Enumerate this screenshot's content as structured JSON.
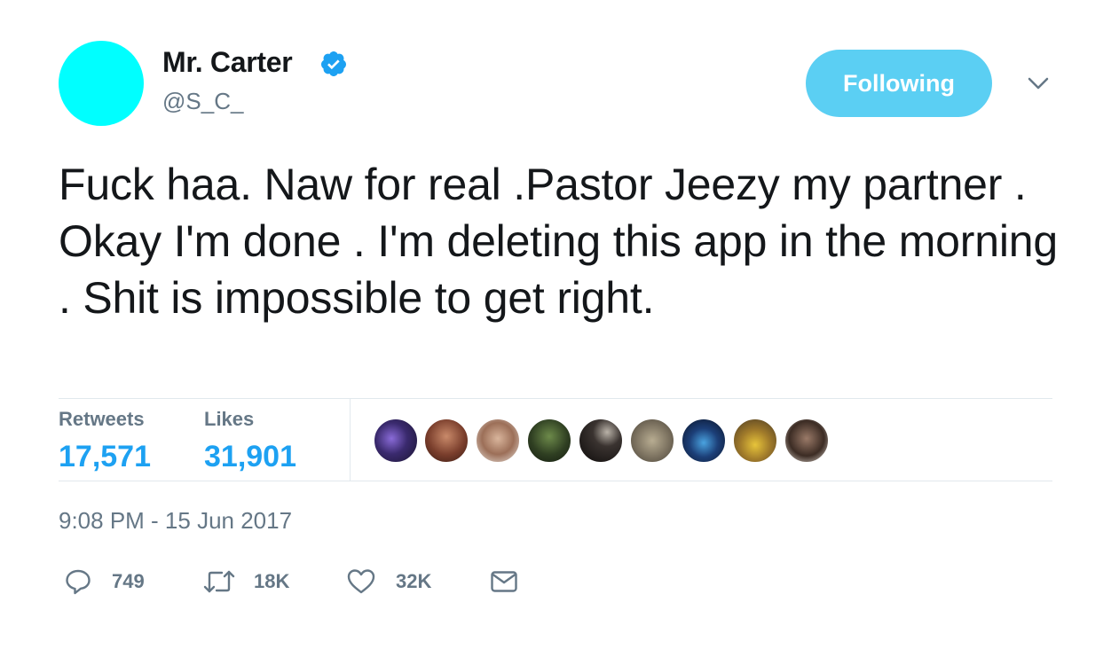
{
  "author": {
    "name": "Mr. Carter",
    "handle": "@S_C_",
    "verified": true,
    "avatar_color": "#00ffff",
    "avatar_icon": "avatar"
  },
  "follow_button": {
    "label": "Following",
    "color": "#5bcff3"
  },
  "menu": {
    "icon": "chevron-down-icon"
  },
  "tweet": {
    "text": "Fuck haa. Naw for real .Pastor Jeezy my partner . Okay I'm done . I'm deleting this app in the morning . Shit is impossible to get right."
  },
  "stats": {
    "retweets_label": "Retweets",
    "retweets_value": "17,571",
    "likes_label": "Likes",
    "likes_value": "31,901",
    "value_color": "#1da1f2"
  },
  "likers": [
    {
      "icon": "liker-avatar-1"
    },
    {
      "icon": "liker-avatar-2"
    },
    {
      "icon": "liker-avatar-3"
    },
    {
      "icon": "liker-avatar-4"
    },
    {
      "icon": "liker-avatar-5"
    },
    {
      "icon": "liker-avatar-6"
    },
    {
      "icon": "liker-avatar-7"
    },
    {
      "icon": "liker-avatar-8"
    },
    {
      "icon": "liker-avatar-9"
    }
  ],
  "timestamp": "9:08 PM - 15 Jun 2017",
  "actions": {
    "reply_count": "749",
    "retweet_count": "18K",
    "like_count": "32K",
    "reply_icon": "reply-icon",
    "retweet_icon": "retweet-icon",
    "like_icon": "heart-icon",
    "dm_icon": "envelope-icon"
  }
}
